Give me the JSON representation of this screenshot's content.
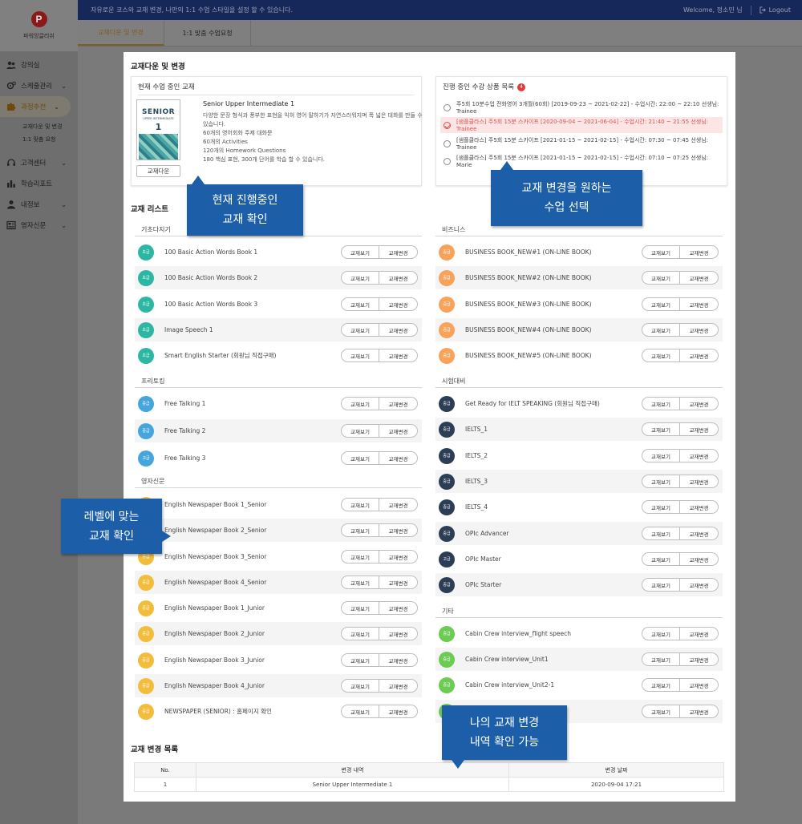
{
  "sidebar": {
    "logo_text": "파워잉글리쉬",
    "logo_letter": "P",
    "items": [
      {
        "label": "강의실",
        "icon": "users-icon",
        "chevron": false
      },
      {
        "label": "스케줄관리",
        "icon": "gear-clock-icon",
        "chevron": true
      },
      {
        "label": "과정추천",
        "icon": "puzzle-icon",
        "chevron": true,
        "active": true
      },
      {
        "label": "고객센터",
        "icon": "headset-icon",
        "chevron": true
      },
      {
        "label": "학습리포트",
        "icon": "bar-chart-icon",
        "chevron": false
      },
      {
        "label": "내정보",
        "icon": "user-icon",
        "chevron": true
      },
      {
        "label": "영자신문",
        "icon": "newspaper-icon",
        "chevron": true
      }
    ],
    "subitems": [
      "교재다운 및 변경",
      "1:1 맞춤 요청"
    ]
  },
  "topbar": {
    "notice": "자유로운 코스와 교재 변경, 나만의 1:1 수업 스타일을 설정 할 수 있습니다.",
    "welcome": "Welcome, 정소민 님",
    "logout": "Logout"
  },
  "tabs": [
    "교재다운 및 변경",
    "1:1 맞춤 수업요청"
  ],
  "page_title": "교재다운 및 변경",
  "current_box": {
    "title": "현재 수업 중인 교재",
    "cover_title": "SENIOR",
    "cover_sub": "UPPER INTERMEDIATE",
    "cover_num": "1",
    "download_btn": "교재다운",
    "book_name": "Senior Upper Intermediate 1",
    "description": "다양한 문장 형식과 풍부한 표현을 익혀 영어 말하기가 자연스러워지며 폭 넓은 대화를 만들 수 있습니다.",
    "details": [
      "60개의 영어회화 주제 대화문",
      "60개의 Activities",
      "120개의 Homework Questions",
      "180 핵심 표현, 300개 단어를 학습 할 수 있습니다."
    ]
  },
  "progress_box": {
    "title": "진행 중인 수강 상품 목록",
    "badge": "4",
    "rows": [
      {
        "text": "주5회 10분수업 전화영어 3개월(60회) [2019-09-23 ~ 2021-02-22] - 수업시간: 22:00 ~ 22:10 선생님: Trainee",
        "selected": false
      },
      {
        "text": "[샘플클라스] 주5회 15분 스카이프 [2020-09-04 ~ 2021-06-04] - 수업시간: 21:40 ~ 21:55 선생님: Trainee",
        "selected": true
      },
      {
        "text": "[샘플클라스] 주5회 15분 스카이프 [2021-01-15 ~ 2021-02-15] - 수업시간: 07:30 ~ 07:45 선생님: Trainee",
        "selected": false
      },
      {
        "text": "[샘플클라스] 주5회 15분 스카이프 [2021-01-15 ~ 2021-02-15] - 수업시간: 07:10 ~ 07:25 선생님: Marie",
        "selected": false
      }
    ]
  },
  "book_list_title": "교재 리스트",
  "btn_view": "교재보기",
  "btn_change": "교재변경",
  "colors": {
    "green": "#2db7a3",
    "blue": "#46a6dc",
    "yellow": "#f2bd3c",
    "orange": "#f7a35c",
    "navy": "#2c3e55",
    "lime": "#6ccb52"
  },
  "left_categories": [
    {
      "name": "기초다지기",
      "books": [
        {
          "level": "초급",
          "color": "green",
          "name": "100 Basic Action Words Book 1"
        },
        {
          "level": "초급",
          "color": "green",
          "name": "100 Basic Action Words Book 2"
        },
        {
          "level": "초급",
          "color": "green",
          "name": "100 Basic Action Words Book 3"
        },
        {
          "level": "초급",
          "color": "green",
          "name": "Image Speech 1"
        },
        {
          "level": "초급",
          "color": "green",
          "name": "Smart English Starter (회원님 직접구매)"
        }
      ]
    },
    {
      "name": "프리토킹",
      "books": [
        {
          "level": "중급",
          "color": "blue",
          "name": "Free Talking 1"
        },
        {
          "level": "중급",
          "color": "blue",
          "name": "Free Talking 2"
        },
        {
          "level": "고급",
          "color": "blue",
          "name": "Free Talking 3"
        }
      ]
    },
    {
      "name": "영자신문",
      "books": [
        {
          "level": "중급",
          "color": "yellow",
          "name": "English Newspaper Book 1_Senior"
        },
        {
          "level": "중급",
          "color": "yellow",
          "name": "English Newspaper Book 2_Senior"
        },
        {
          "level": "중급",
          "color": "yellow",
          "name": "English Newspaper Book 3_Senior"
        },
        {
          "level": "중급",
          "color": "yellow",
          "name": "English Newspaper Book 4_Senior"
        },
        {
          "level": "중급",
          "color": "yellow",
          "name": "English Newspaper Book 1_Junior"
        },
        {
          "level": "중급",
          "color": "yellow",
          "name": "English Newspaper Book 2_Junior"
        },
        {
          "level": "중급",
          "color": "yellow",
          "name": "English Newspaper Book 3_Junior"
        },
        {
          "level": "중급",
          "color": "yellow",
          "name": "English Newspaper Book 4_Junior"
        },
        {
          "level": "중급",
          "color": "yellow",
          "name": "NEWSPAPER (SENIOR) : 홈페이지 확인"
        }
      ]
    }
  ],
  "right_categories": [
    {
      "name": "비즈니스",
      "books": [
        {
          "level": "중급",
          "color": "orange",
          "name": "BUSINESS BOOK_NEW#1 (ON-LINE BOOK)"
        },
        {
          "level": "중급",
          "color": "orange",
          "name": "BUSINESS BOOK_NEW#2 (ON-LINE BOOK)"
        },
        {
          "level": "중급",
          "color": "orange",
          "name": "BUSINESS BOOK_NEW#3 (ON-LINE BOOK)"
        },
        {
          "level": "중급",
          "color": "orange",
          "name": "BUSINESS BOOK_NEW#4 (ON-LINE BOOK)"
        },
        {
          "level": "중급",
          "color": "orange",
          "name": "BUSINESS BOOK_NEW#5 (ON-LINE BOOK)"
        }
      ]
    },
    {
      "name": "시험대비",
      "books": [
        {
          "level": "중급",
          "color": "navy",
          "name": "Get Ready for IELT SPEAKING (회원님 직접구매)"
        },
        {
          "level": "중급",
          "color": "navy",
          "name": "IELTS_1"
        },
        {
          "level": "중급",
          "color": "navy",
          "name": "IELTS_2"
        },
        {
          "level": "중급",
          "color": "navy",
          "name": "IELTS_3"
        },
        {
          "level": "중급",
          "color": "navy",
          "name": "IELTS_4"
        },
        {
          "level": "중급",
          "color": "navy",
          "name": "OPIc Advancer"
        },
        {
          "level": "고급",
          "color": "navy",
          "name": "OPIc Master"
        },
        {
          "level": "중급",
          "color": "navy",
          "name": "OPIc Starter"
        }
      ]
    },
    {
      "name": "기타",
      "books": [
        {
          "level": "중급",
          "color": "lime",
          "name": "Cabin Crew interview_flight speech"
        },
        {
          "level": "중급",
          "color": "lime",
          "name": "Cabin Crew interview_Unit1"
        },
        {
          "level": "중급",
          "color": "lime",
          "name": "Cabin Crew interview_Unit2-1"
        },
        {
          "level": "중급",
          "color": "lime",
          "name": ""
        }
      ]
    }
  ],
  "history": {
    "title": "교재 변경 목록",
    "headers": [
      "No.",
      "변경 내역",
      "변경 날짜"
    ],
    "rows": [
      [
        "1",
        "Senior Upper Intermediate 1",
        "2020-09-04 17:21"
      ]
    ]
  },
  "callouts": {
    "current": [
      "현재 진행중인",
      "교재 확인"
    ],
    "select": [
      "교재 변경을 원하는",
      "수업 선택"
    ],
    "level": [
      "레벨에 맞는",
      "교재 확인"
    ],
    "history": [
      "나의 교재 변경",
      "내역 확인 가능"
    ]
  }
}
